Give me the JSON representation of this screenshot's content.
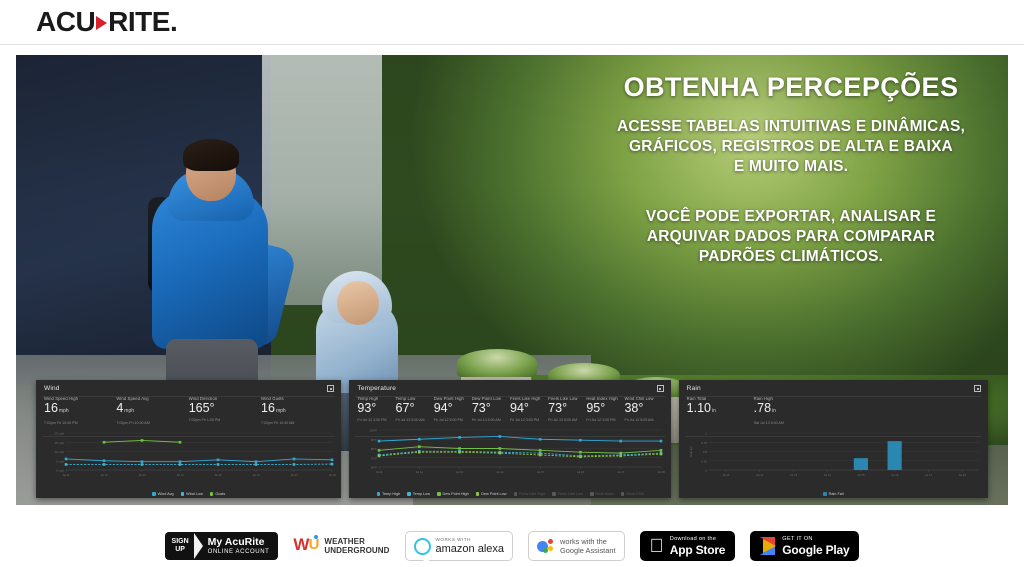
{
  "header": {
    "logo_text_1": "ACU",
    "logo_text_2": "RITE",
    "logo_dot": ".",
    "logo_arrow_icon": "right-arrow-icon"
  },
  "hero": {
    "headline": "OBTENHA PERCEPÇÕES",
    "paragraph1_line1": "ACESSE TABELAS INTUITIVAS E DINÂMICAS,",
    "paragraph1_line2": "GRÁFICOS, REGISTROS DE ALTA E BAIXA",
    "paragraph1_line3": "E MUITO MAIS.",
    "paragraph2_line1": "VOCÊ PODE EXPORTAR, ANALISAR E",
    "paragraph2_line2": "ARQUIVAR DADOS PARA COMPARAR",
    "paragraph2_line3": "PADRÕES CLIMÁTICOS."
  },
  "panels": {
    "wind": {
      "title": "Wind",
      "expand_icon": "expand-icon",
      "stats": [
        {
          "label": "Wind Speed High",
          "value": "16",
          "unit": "mph",
          "time": "7:02pm Fri 10:30 PM"
        },
        {
          "label": "Wind Speed Avg",
          "value": "4",
          "unit": "mph",
          "time": "7:02pm Fri 10:30 AM"
        },
        {
          "label": "Wind Direction",
          "value": "165°",
          "unit": "",
          "time": "7:02pm Fri 1:30 PM"
        },
        {
          "label": "Wind Gusts",
          "value": "16",
          "unit": "mph",
          "time": "7:02pm Fri 10:30 AM"
        }
      ],
      "legend": [
        {
          "label": "Wind Avg",
          "color": "#31a8d8",
          "active": true
        },
        {
          "label": "Wind Low",
          "color": "#3fb6d6",
          "active": true
        },
        {
          "label": "Gusts",
          "color": "#74c043",
          "active": true
        }
      ]
    },
    "temperature": {
      "title": "Temperature",
      "expand_icon": "expand-icon",
      "stats": [
        {
          "label": "Temp High",
          "value": "93°",
          "time": "Fri Jul 12 3:00 PM"
        },
        {
          "label": "Temp Low",
          "value": "67°",
          "time": "Fri Jul 13 5:00 AM"
        },
        {
          "label": "Dew Point High",
          "value": "94°",
          "time": "Fri Jul 12 5:00 PM"
        },
        {
          "label": "Dew Point Low",
          "value": "73°",
          "time": "Fri Jul 13 5:00 AM"
        },
        {
          "label": "Feels Like High",
          "value": "94°",
          "time": "Fri Jul 12 3:00 PM"
        },
        {
          "label": "Feels Like Low",
          "value": "73°",
          "time": "Fri Jul 13 5:00 AM"
        },
        {
          "label": "Heat Index High",
          "value": "95°",
          "time": "Fri Jul 12 3:00 PM"
        },
        {
          "label": "Wind Chill Low",
          "value": "38°",
          "time": "Fri Jul 13 5:00 AM"
        }
      ],
      "legend": [
        {
          "label": "Temp High",
          "color": "#31a8d8",
          "active": true
        },
        {
          "label": "Temp Low",
          "color": "#3fb6d6",
          "active": true
        },
        {
          "label": "Dew Point High",
          "color": "#74c043",
          "active": true
        },
        {
          "label": "Dew Point Low",
          "color": "#8bc34a",
          "active": true
        },
        {
          "label": "Feels Like High",
          "color": "#585858",
          "active": false
        },
        {
          "label": "Feels Like Low",
          "color": "#585858",
          "active": false
        },
        {
          "label": "Heat Index",
          "color": "#585858",
          "active": false
        },
        {
          "label": "Wind Chill",
          "color": "#585858",
          "active": false
        }
      ]
    },
    "rain": {
      "title": "Rain",
      "expand_icon": "expand-icon",
      "stats": [
        {
          "label": "Rain Total",
          "value": "1.10",
          "unit": "in",
          "time": ""
        },
        {
          "label": "Rain High",
          "value": ".78",
          "unit": "in",
          "time": "Sat Jul 13 5:00 AM"
        }
      ],
      "legend": [
        {
          "label": "Rain Fall",
          "color": "#2b87b0",
          "active": true
        }
      ]
    }
  },
  "chart_data": [
    {
      "type": "line",
      "title": "Wind",
      "xlabel": "",
      "ylabel": "mph",
      "x": [
        "Jul 11",
        "Jul 12",
        "Jul 13",
        "Jul 14",
        "Jul 15",
        "Jul 16",
        "Jul 17",
        "Jul 18"
      ],
      "ylim": [
        0,
        20
      ],
      "yticks": [
        "20 mph",
        "15 mph",
        "10 mph",
        "5 mph",
        "0 mph"
      ],
      "grid": true,
      "legend_position": "bottom",
      "series": [
        {
          "name": "Gusts",
          "color": "#74c043",
          "values": [
            null,
            15,
            16,
            15,
            null,
            null,
            null,
            null
          ]
        },
        {
          "name": "Wind Avg",
          "color": "#31a8d8",
          "values": [
            6,
            5,
            4.5,
            4.5,
            5.5,
            4.5,
            6,
            5.5
          ]
        },
        {
          "name": "Wind Low",
          "color": "#3fb6d6",
          "values": [
            3,
            3,
            3,
            3,
            3,
            3,
            3,
            3.2
          ],
          "dashed": true
        }
      ]
    },
    {
      "type": "line",
      "title": "Temperature",
      "xlabel": "",
      "ylabel": "°F",
      "x": [
        "Jul 11",
        "Jul 12",
        "Jul 13",
        "Jul 14",
        "Jul 15",
        "Jul 16",
        "Jul 17",
        "Jul 18"
      ],
      "ylim": [
        60,
        100
      ],
      "yticks": [
        "100°F",
        "90°F",
        "80°F",
        "70°F",
        "60°F"
      ],
      "grid": true,
      "legend_position": "bottom",
      "series": [
        {
          "name": "Temp High",
          "color": "#31a8d8",
          "values": [
            88,
            90,
            92,
            93,
            90,
            89,
            88,
            88
          ]
        },
        {
          "name": "Dew Point High",
          "color": "#74c043",
          "values": [
            78,
            82,
            80,
            80,
            78,
            76,
            75,
            78
          ]
        },
        {
          "name": "Temp Low",
          "color": "#3fb6d6",
          "values": [
            73,
            77,
            77,
            76,
            75,
            72,
            73,
            75
          ],
          "dashed": true
        },
        {
          "name": "Dew Point Low",
          "color": "#8bc34a",
          "values": [
            72,
            76,
            76,
            75,
            73,
            71,
            72,
            74
          ],
          "dashed": true
        }
      ]
    },
    {
      "type": "bar",
      "title": "Rain",
      "xlabel": "",
      "ylabel": "Rain (in)",
      "categories": [
        "Jul 11",
        "Jul 12",
        "Jul 13",
        "Jul 14",
        "Jul 15",
        "Jul 16",
        "Jul 17",
        "Jul 18"
      ],
      "values": [
        0,
        0,
        0,
        0,
        0.32,
        0.78,
        0,
        0
      ],
      "ylim": [
        0,
        1
      ],
      "yticks": [
        "1",
        "0.75",
        "0.5",
        "0.25",
        "0"
      ],
      "grid": true,
      "color": "#2b87b0",
      "legend_position": "bottom"
    }
  ],
  "badges": {
    "signup": {
      "line1": "SIGN",
      "line2": "UP",
      "title": "My AcuRite",
      "subtitle": "ONLINE ACCOUNT",
      "chevron_icon": "chevron-right-icon"
    },
    "weather_underground": {
      "mark": "WU",
      "line1": "WEATHER",
      "line2": "UNDERGROUND",
      "icon": "wu-logo-icon"
    },
    "alexa": {
      "small": "WORKS WITH",
      "big": "amazon alexa",
      "icon": "alexa-ring-icon"
    },
    "google_assistant": {
      "line1": "works with the",
      "line2": "Google Assistant",
      "icon": "google-assistant-icon"
    },
    "app_store": {
      "small": "Download on the",
      "big": "App Store",
      "icon": "apple-icon"
    },
    "google_play": {
      "small": "GET IT ON",
      "big": "Google Play",
      "icon": "google-play-icon"
    }
  }
}
